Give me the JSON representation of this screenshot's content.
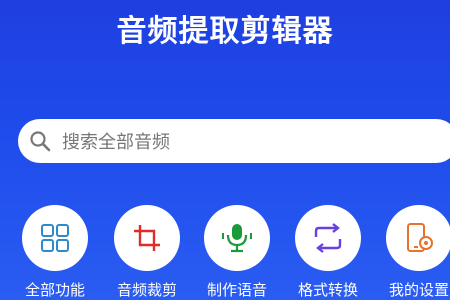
{
  "app": {
    "title": "音频提取剪辑器"
  },
  "search": {
    "placeholder": "搜索全部音频"
  },
  "features": [
    {
      "label": "全部功能",
      "icon": "grid-icon",
      "color": "#2f8ac9"
    },
    {
      "label": "音频裁剪",
      "icon": "crop-icon",
      "color": "#e02b2b"
    },
    {
      "label": "制作语音",
      "icon": "microphone-icon",
      "color": "#1b9a3a"
    },
    {
      "label": "格式转换",
      "icon": "convert-arrows-icon",
      "color": "#6a3fe0"
    },
    {
      "label": "我的设置",
      "icon": "phone-gear-icon",
      "color": "#e8722a"
    }
  ]
}
